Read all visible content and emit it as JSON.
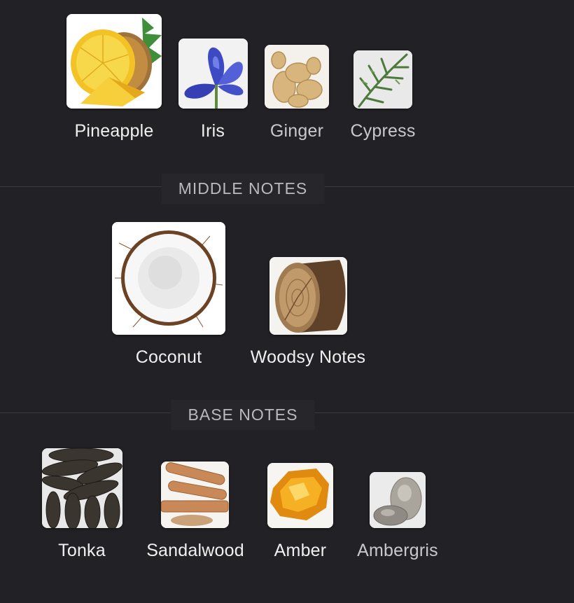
{
  "top_notes": [
    {
      "name": "Pineapple",
      "icon": "pineapple-image"
    },
    {
      "name": "Iris",
      "icon": "iris-flower-image"
    },
    {
      "name": "Ginger",
      "icon": "ginger-root-image"
    },
    {
      "name": "Cypress",
      "icon": "cypress-branch-image"
    }
  ],
  "middle_notes_title": "MIDDLE NOTES",
  "middle_notes": [
    {
      "name": "Coconut",
      "icon": "coconut-image"
    },
    {
      "name": "Woodsy Notes",
      "icon": "wood-log-image"
    }
  ],
  "base_notes_title": "BASE NOTES",
  "base_notes": [
    {
      "name": "Tonka",
      "icon": "tonka-bean-image"
    },
    {
      "name": "Sandalwood",
      "icon": "sandalwood-sticks-image"
    },
    {
      "name": "Amber",
      "icon": "amber-resin-image"
    },
    {
      "name": "Ambergris",
      "icon": "ambergris-stones-image"
    }
  ]
}
